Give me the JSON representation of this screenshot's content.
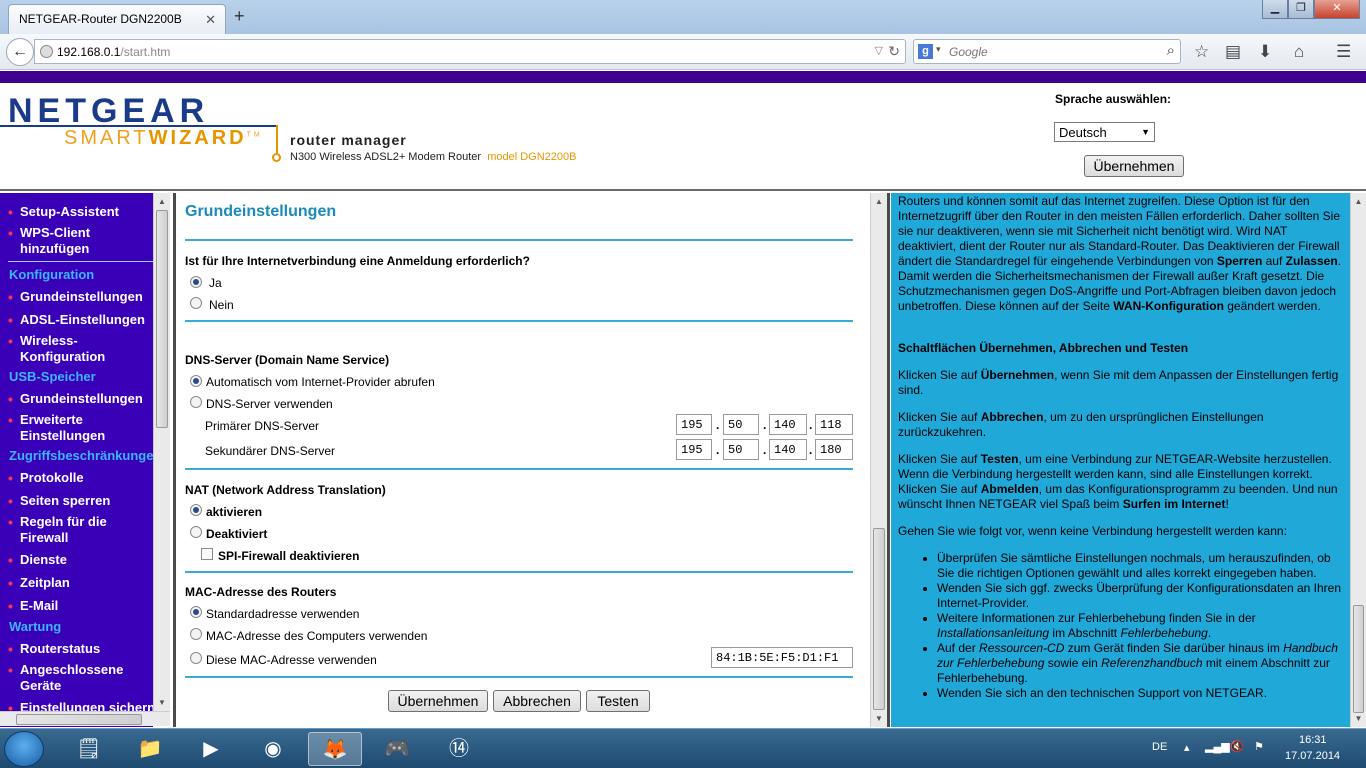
{
  "browser": {
    "tab_title": "NETGEAR-Router DGN2200B",
    "url_host": "192.168.0.1",
    "url_path": "/start.htm",
    "search_placeholder": "Google"
  },
  "header": {
    "logo_main": "NETGEAR",
    "logo_smart": "SMART",
    "logo_wizard": "WIZARD",
    "logo_tm": "TM",
    "manager_title": "router manager",
    "product": "N300 Wireless ADSL2+ Modem Router",
    "model": "model DGN2200B",
    "lang_label": "Sprache auswählen:",
    "lang_value": "Deutsch",
    "lang_apply": "Übernehmen"
  },
  "nav": {
    "items": [
      {
        "label": "Setup-Assistent",
        "type": "item"
      },
      {
        "label": "WPS-Client hinzufügen",
        "type": "item"
      },
      {
        "label": "Konfiguration",
        "type": "head"
      },
      {
        "label": "Grundeinstellungen",
        "type": "item"
      },
      {
        "label": "ADSL-Einstellungen",
        "type": "item"
      },
      {
        "label": "Wireless-Konfiguration",
        "type": "item"
      },
      {
        "label": "USB-Speicher",
        "type": "head"
      },
      {
        "label": "Grundeinstellungen",
        "type": "item"
      },
      {
        "label": "Erweiterte Einstellungen",
        "type": "item"
      },
      {
        "label": "Zugriffsbeschränkungen",
        "type": "head"
      },
      {
        "label": "Protokolle",
        "type": "item"
      },
      {
        "label": "Seiten sperren",
        "type": "item"
      },
      {
        "label": "Regeln für die Firewall",
        "type": "item"
      },
      {
        "label": "Dienste",
        "type": "item"
      },
      {
        "label": "Zeitplan",
        "type": "item"
      },
      {
        "label": "E-Mail",
        "type": "item"
      },
      {
        "label": "Wartung",
        "type": "head"
      },
      {
        "label": "Routerstatus",
        "type": "item"
      },
      {
        "label": "Angeschlossene Geräte",
        "type": "item"
      },
      {
        "label": "Einstellungen sichern",
        "type": "item"
      }
    ]
  },
  "main": {
    "title": "Grundeinstellungen",
    "login_q": "Ist für Ihre Internetverbindung eine Anmeldung erforderlich?",
    "login_yes": "Ja",
    "login_no": "Nein",
    "dns_title": "DNS-Server (Domain Name Service)",
    "dns_auto": "Automatisch vom Internet-Provider abrufen",
    "dns_manual": "DNS-Server verwenden",
    "dns_primary_label": "Primärer DNS-Server",
    "dns_secondary_label": "Sekundärer DNS-Server",
    "dns_primary": [
      "195",
      "50",
      "140",
      "118"
    ],
    "dns_secondary": [
      "195",
      "50",
      "140",
      "180"
    ],
    "nat_title": "NAT (Network Address Translation)",
    "nat_on": "aktivieren",
    "nat_off": "Deaktiviert",
    "spi": "SPI-Firewall deaktivieren",
    "mac_title": "MAC-Adresse des Routers",
    "mac_default": "Standardadresse verwenden",
    "mac_computer": "MAC-Adresse des Computers verwenden",
    "mac_custom": "Diese MAC-Adresse verwenden",
    "mac_value": "84:1B:5E:F5:D1:F1",
    "btn_apply": "Übernehmen",
    "btn_cancel": "Abbrechen",
    "btn_test": "Testen"
  },
  "help": {
    "p1a": "Routers und können somit auf das Internet zugreifen. Diese Option ist für den Internetzugriff über den Router in den meisten Fällen erforderlich. Daher sollten Sie sie nur deaktiveren, wenn sie mit Sicherheit nicht benötigt wird. Wird NAT deaktiviert, dient der Router nur als Standard-Router. Das Deaktivieren der Firewall ändert die Standardregel für eingehende Verbindungen von ",
    "p1b": "Sperren",
    "p1c": " auf ",
    "p1d": "Zulassen",
    "p1e": ". Damit werden die Sicherheitsmechanismen der Firewall außer Kraft gesetzt. Die Schutzmechanismen gegen DoS-Angriffe und Port-Abfragen bleiben davon jedoch unbetroffen. Diese können auf der Seite ",
    "p1f": "WAN-Konfiguration",
    "p1g": " geändert werden.",
    "h2": "Schaltflächen Übernehmen, Abbrechen und Testen",
    "p2a": "Klicken Sie auf ",
    "p2b": "Übernehmen",
    "p2c": ", wenn Sie mit dem Anpassen der Einstellungen fertig sind.",
    "p3a": "Klicken Sie auf ",
    "p3b": "Abbrechen",
    "p3c": ", um zu den ursprünglichen Einstellungen zurückzukehren.",
    "p4a": "Klicken Sie auf ",
    "p4b": "Testen",
    "p4c": ", um eine Verbindung zur NETGEAR-Website herzustellen. Wenn die Verbindung hergestellt werden kann, sind alle Einstellungen korrekt. Klicken Sie auf ",
    "p4d": "Abmelden",
    "p4e": ", um das Konfigurationsprogramm zu beenden. Und nun wünscht Ihnen NETGEAR viel Spaß beim ",
    "p4f": "Surfen im Internet",
    "p4g": "!",
    "p5": "Gehen Sie wie folgt vor, wenn keine Verbindung hergestellt werden kann:",
    "li1": "Überprüfen Sie sämtliche Einstellungen nochmals, um herauszufinden, ob Sie die richtigen Optionen gewählt und alles korrekt eingegeben haben.",
    "li2": "Wenden Sie sich ggf. zwecks Überprüfung der Konfigurationsdaten an Ihren Internet-Provider.",
    "li3a": "Weitere Informationen zur Fehlerbehebung finden Sie in der ",
    "li3b": "Installationsanleitung",
    "li3c": " im Abschnitt ",
    "li3d": "Fehlerbehebung",
    "li3e": ".",
    "li4a": "Auf der ",
    "li4b": "Ressourcen-CD",
    "li4c": " zum Gerät finden Sie darüber hinaus im ",
    "li4d": "Handbuch zur Fehlerbehebung",
    "li4e": " sowie ein ",
    "li4f": "Referenzhandbuch",
    "li4g": " mit einem Abschnitt zur Fehlerbehebung.",
    "li5": "Wenden Sie sich an den technischen Support von NETGEAR."
  },
  "taskbar": {
    "lang": "DE",
    "time": "16:31",
    "date": "17.07.2014"
  }
}
